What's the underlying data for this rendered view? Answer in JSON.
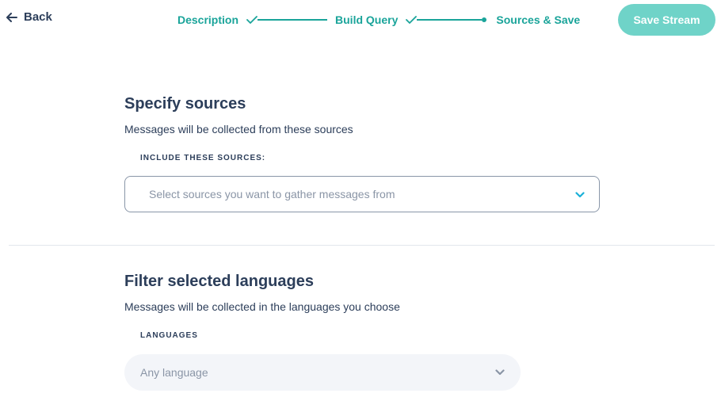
{
  "header": {
    "back_label": "Back",
    "steps": [
      {
        "label": "Description",
        "state": "done"
      },
      {
        "label": "Build Query",
        "state": "done"
      },
      {
        "label": "Sources & Save",
        "state": "current"
      }
    ],
    "save_label": "Save Stream"
  },
  "sources": {
    "title": "Specify sources",
    "subtitle": "Messages will be collected from these sources",
    "field_label": "INCLUDE THESE SOURCES:",
    "placeholder": "Select sources you want to gather messages from"
  },
  "languages": {
    "title": "Filter selected languages",
    "subtitle": "Messages will be collected in the languages you choose",
    "field_label": "LANGUAGES",
    "value": "Any language"
  },
  "colors": {
    "accent": "#1aa49a",
    "button": "#6fd3c8",
    "text": "#2c3e5a",
    "chevron_sources": "#1ab0d8",
    "chevron_languages": "#8a95a6"
  },
  "icons": [
    "arrow-left-icon",
    "check-icon",
    "chevron-down-icon"
  ]
}
